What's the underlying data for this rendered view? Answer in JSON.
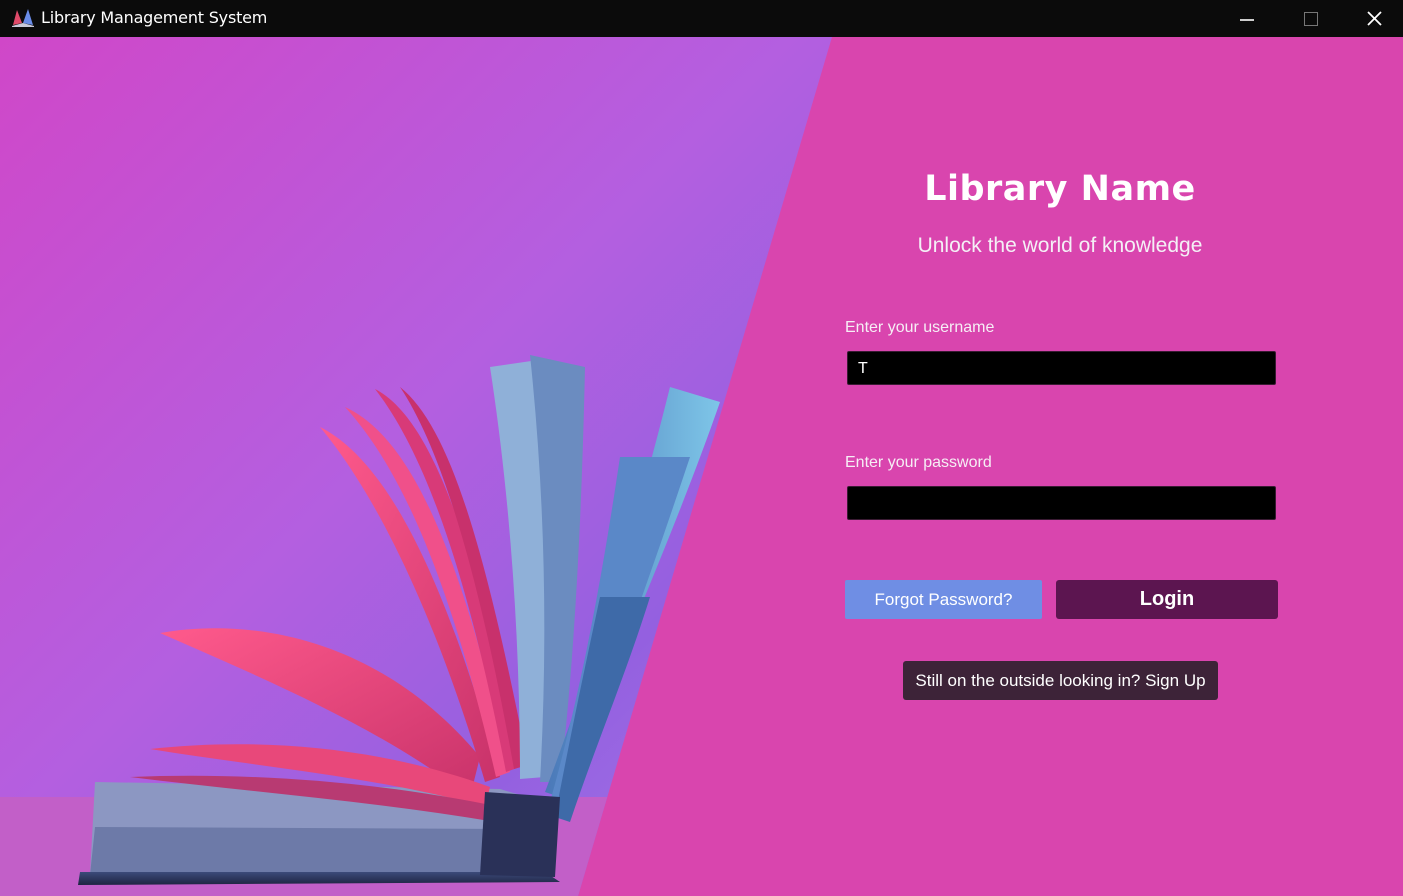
{
  "window": {
    "title": "Library Management System",
    "icons": {
      "app": "book-icon",
      "minimize": "minimize-icon",
      "maximize": "maximize-icon",
      "close": "close-icon"
    }
  },
  "colors": {
    "panel_bg": "#d945ae",
    "login_button": "#5c1550",
    "forgot_button": "#6f8ee4",
    "signup_button": "#3d2338",
    "input_bg": "#000000"
  },
  "branding": {
    "name": "Library Name",
    "tagline": "Unlock the world of knowledge"
  },
  "form": {
    "username_label": "Enter your username",
    "username_value": "T",
    "password_label": "Enter your password",
    "password_value": "",
    "forgot_label": "Forgot Password?",
    "login_label": "Login",
    "signup_label": "Still on the outside looking in? Sign Up"
  }
}
